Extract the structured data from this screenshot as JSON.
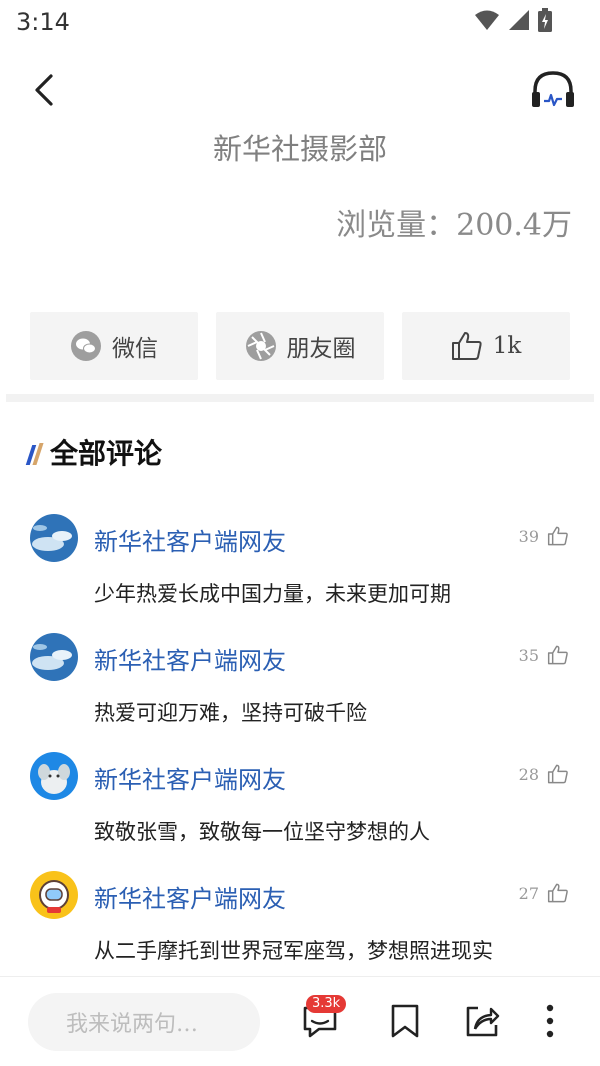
{
  "status": {
    "time": "3:14"
  },
  "article": {
    "source": "新华社摄影部",
    "views": "浏览量：200.4万"
  },
  "share": {
    "wechat_label": "微信",
    "moments_label": "朋友圈",
    "like_count": "1k"
  },
  "comments_section": {
    "title": "全部评论",
    "items": [
      {
        "user": "新华社客户端网友",
        "likes": "39",
        "text": "少年热爱长成中国力量，未来更加可期",
        "avatar_icon": "sky-avatar-icon"
      },
      {
        "user": "新华社客户端网友",
        "likes": "35",
        "text": "热爱可迎万难，坚持可破千险",
        "avatar_icon": "sky-avatar-icon"
      },
      {
        "user": "新华社客户端网友",
        "likes": "28",
        "text": "致敬张雪，致敬每一位坚守梦想的人",
        "avatar_icon": "elephant-avatar-icon"
      },
      {
        "user": "新华社客户端网友",
        "likes": "27",
        "text": "从二手摩托到世界冠军座驾，梦想照进现实",
        "avatar_icon": "astronaut-avatar-icon"
      }
    ]
  },
  "bottom_bar": {
    "input_placeholder": "我来说两句…",
    "comment_badge": "3.3k"
  },
  "colors": {
    "username": "#2b5fb3",
    "badge": "#e53935",
    "accent_blue": "#2a56c6",
    "accent_gold": "#d6a56a"
  }
}
